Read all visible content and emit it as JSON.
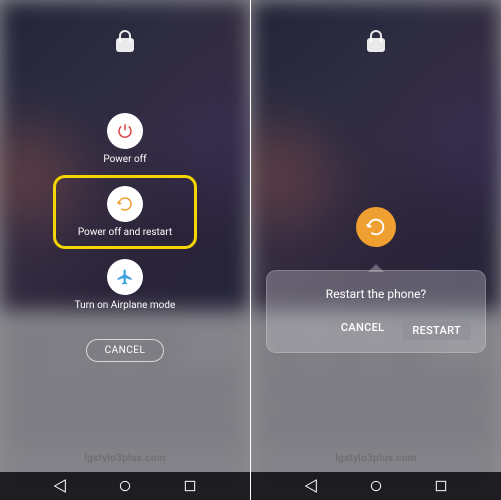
{
  "left": {
    "menu": {
      "power_off": "Power off",
      "restart": "Power off and restart",
      "airplane": "Turn on Airplane mode"
    },
    "cancel": "CANCEL"
  },
  "right": {
    "dialog": {
      "title": "Restart the phone?",
      "cancel": "CANCEL",
      "confirm": "RESTART"
    }
  },
  "watermark": "lgstylo3plus.com",
  "colors": {
    "highlight": "#f5d500",
    "accent": "#f0a030",
    "power_icon": "#d44",
    "restart_icon": "#f0a030",
    "airplane_icon": "#3aa0e0"
  }
}
